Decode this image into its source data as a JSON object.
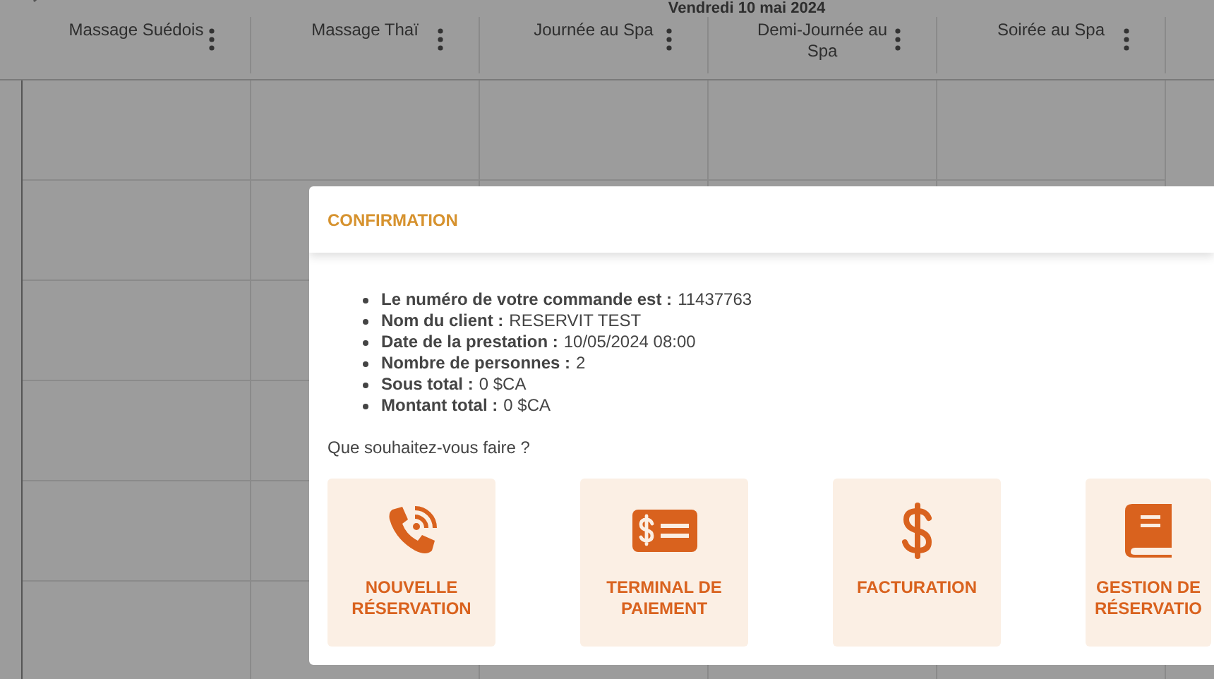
{
  "calendar": {
    "date_title": "Vendredi 10 mai 2024",
    "columns": [
      {
        "label": "Massage Suédois"
      },
      {
        "label": "Massage Thaï"
      },
      {
        "label": "Journée au Spa"
      },
      {
        "label": "Demi-Journée au Spa"
      },
      {
        "label": "Soirée au Spa"
      }
    ]
  },
  "dialog": {
    "title": "CONFIRMATION",
    "details": [
      {
        "label": "Le numéro de votre commande est :",
        "value": "11437763"
      },
      {
        "label": "Nom du client :",
        "value": "RESERVIT TEST"
      },
      {
        "label": "Date de la prestation :",
        "value": "10/05/2024 08:00"
      },
      {
        "label": "Nombre de personnes :",
        "value": "2"
      },
      {
        "label": "Sous total :",
        "value": "0 $CA"
      },
      {
        "label": "Montant total :",
        "value": "0 $CA"
      }
    ],
    "prompt": "Que souhaitez-vous faire ?",
    "actions": [
      {
        "kind": "phone",
        "label": "NOUVELLE RÉSERVATION"
      },
      {
        "kind": "card",
        "label": "TERMINAL DE PAIEMENT"
      },
      {
        "kind": "dollar",
        "label": "FACTURATION"
      },
      {
        "kind": "book",
        "label": "GESTION DE RÉSERVATIO"
      }
    ]
  }
}
